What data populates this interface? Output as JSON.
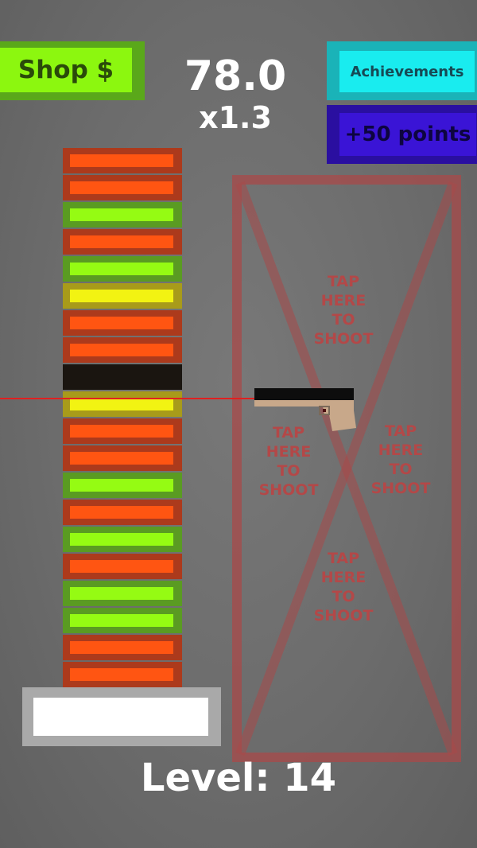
{
  "header": {
    "shop_label": "Shop $",
    "achievements_label": "Achievements",
    "bonus_label": "+50 points",
    "score": "78.0",
    "multiplier": "x1.3"
  },
  "stack": {
    "tiles": [
      "orange",
      "orange",
      "green",
      "orange",
      "green",
      "yellow",
      "orange",
      "orange",
      "dark",
      "yellow",
      "orange",
      "orange",
      "green",
      "orange",
      "green",
      "orange",
      "green",
      "green",
      "orange",
      "orange"
    ]
  },
  "shoot_zone": {
    "label_line1": "TAP",
    "label_line2": "HERE",
    "label_line3": "TO",
    "label_line4": "SHOOT"
  },
  "power_meter": {
    "fill": 1.0
  },
  "footer": {
    "level_text": "Level: 14"
  },
  "colors": {
    "orange": "#ff5512",
    "green": "#95fb13",
    "yellow": "#f2f312",
    "zone_outline": "#a84a4a"
  }
}
